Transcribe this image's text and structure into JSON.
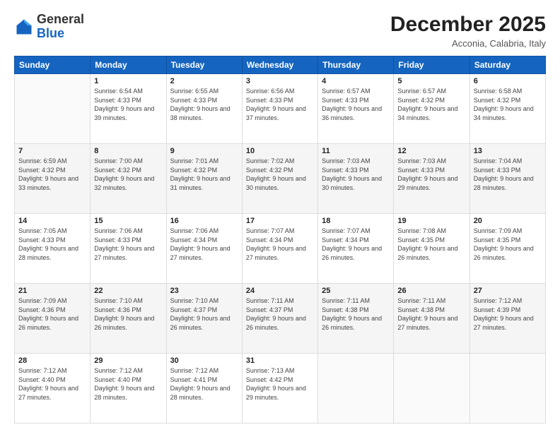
{
  "header": {
    "logo_general": "General",
    "logo_blue": "Blue",
    "title": "December 2025",
    "subtitle": "Acconia, Calabria, Italy"
  },
  "weekdays": [
    "Sunday",
    "Monday",
    "Tuesday",
    "Wednesday",
    "Thursday",
    "Friday",
    "Saturday"
  ],
  "weeks": [
    [
      {
        "day": "",
        "sunrise": "",
        "sunset": "",
        "daylight": ""
      },
      {
        "day": "1",
        "sunrise": "Sunrise: 6:54 AM",
        "sunset": "Sunset: 4:33 PM",
        "daylight": "Daylight: 9 hours and 39 minutes."
      },
      {
        "day": "2",
        "sunrise": "Sunrise: 6:55 AM",
        "sunset": "Sunset: 4:33 PM",
        "daylight": "Daylight: 9 hours and 38 minutes."
      },
      {
        "day": "3",
        "sunrise": "Sunrise: 6:56 AM",
        "sunset": "Sunset: 4:33 PM",
        "daylight": "Daylight: 9 hours and 37 minutes."
      },
      {
        "day": "4",
        "sunrise": "Sunrise: 6:57 AM",
        "sunset": "Sunset: 4:33 PM",
        "daylight": "Daylight: 9 hours and 36 minutes."
      },
      {
        "day": "5",
        "sunrise": "Sunrise: 6:57 AM",
        "sunset": "Sunset: 4:32 PM",
        "daylight": "Daylight: 9 hours and 34 minutes."
      },
      {
        "day": "6",
        "sunrise": "Sunrise: 6:58 AM",
        "sunset": "Sunset: 4:32 PM",
        "daylight": "Daylight: 9 hours and 34 minutes."
      }
    ],
    [
      {
        "day": "7",
        "sunrise": "Sunrise: 6:59 AM",
        "sunset": "Sunset: 4:32 PM",
        "daylight": "Daylight: 9 hours and 33 minutes."
      },
      {
        "day": "8",
        "sunrise": "Sunrise: 7:00 AM",
        "sunset": "Sunset: 4:32 PM",
        "daylight": "Daylight: 9 hours and 32 minutes."
      },
      {
        "day": "9",
        "sunrise": "Sunrise: 7:01 AM",
        "sunset": "Sunset: 4:32 PM",
        "daylight": "Daylight: 9 hours and 31 minutes."
      },
      {
        "day": "10",
        "sunrise": "Sunrise: 7:02 AM",
        "sunset": "Sunset: 4:32 PM",
        "daylight": "Daylight: 9 hours and 30 minutes."
      },
      {
        "day": "11",
        "sunrise": "Sunrise: 7:03 AM",
        "sunset": "Sunset: 4:33 PM",
        "daylight": "Daylight: 9 hours and 30 minutes."
      },
      {
        "day": "12",
        "sunrise": "Sunrise: 7:03 AM",
        "sunset": "Sunset: 4:33 PM",
        "daylight": "Daylight: 9 hours and 29 minutes."
      },
      {
        "day": "13",
        "sunrise": "Sunrise: 7:04 AM",
        "sunset": "Sunset: 4:33 PM",
        "daylight": "Daylight: 9 hours and 28 minutes."
      }
    ],
    [
      {
        "day": "14",
        "sunrise": "Sunrise: 7:05 AM",
        "sunset": "Sunset: 4:33 PM",
        "daylight": "Daylight: 9 hours and 28 minutes."
      },
      {
        "day": "15",
        "sunrise": "Sunrise: 7:06 AM",
        "sunset": "Sunset: 4:33 PM",
        "daylight": "Daylight: 9 hours and 27 minutes."
      },
      {
        "day": "16",
        "sunrise": "Sunrise: 7:06 AM",
        "sunset": "Sunset: 4:34 PM",
        "daylight": "Daylight: 9 hours and 27 minutes."
      },
      {
        "day": "17",
        "sunrise": "Sunrise: 7:07 AM",
        "sunset": "Sunset: 4:34 PM",
        "daylight": "Daylight: 9 hours and 27 minutes."
      },
      {
        "day": "18",
        "sunrise": "Sunrise: 7:07 AM",
        "sunset": "Sunset: 4:34 PM",
        "daylight": "Daylight: 9 hours and 26 minutes."
      },
      {
        "day": "19",
        "sunrise": "Sunrise: 7:08 AM",
        "sunset": "Sunset: 4:35 PM",
        "daylight": "Daylight: 9 hours and 26 minutes."
      },
      {
        "day": "20",
        "sunrise": "Sunrise: 7:09 AM",
        "sunset": "Sunset: 4:35 PM",
        "daylight": "Daylight: 9 hours and 26 minutes."
      }
    ],
    [
      {
        "day": "21",
        "sunrise": "Sunrise: 7:09 AM",
        "sunset": "Sunset: 4:36 PM",
        "daylight": "Daylight: 9 hours and 26 minutes."
      },
      {
        "day": "22",
        "sunrise": "Sunrise: 7:10 AM",
        "sunset": "Sunset: 4:36 PM",
        "daylight": "Daylight: 9 hours and 26 minutes."
      },
      {
        "day": "23",
        "sunrise": "Sunrise: 7:10 AM",
        "sunset": "Sunset: 4:37 PM",
        "daylight": "Daylight: 9 hours and 26 minutes."
      },
      {
        "day": "24",
        "sunrise": "Sunrise: 7:11 AM",
        "sunset": "Sunset: 4:37 PM",
        "daylight": "Daylight: 9 hours and 26 minutes."
      },
      {
        "day": "25",
        "sunrise": "Sunrise: 7:11 AM",
        "sunset": "Sunset: 4:38 PM",
        "daylight": "Daylight: 9 hours and 26 minutes."
      },
      {
        "day": "26",
        "sunrise": "Sunrise: 7:11 AM",
        "sunset": "Sunset: 4:38 PM",
        "daylight": "Daylight: 9 hours and 27 minutes."
      },
      {
        "day": "27",
        "sunrise": "Sunrise: 7:12 AM",
        "sunset": "Sunset: 4:39 PM",
        "daylight": "Daylight: 9 hours and 27 minutes."
      }
    ],
    [
      {
        "day": "28",
        "sunrise": "Sunrise: 7:12 AM",
        "sunset": "Sunset: 4:40 PM",
        "daylight": "Daylight: 9 hours and 27 minutes."
      },
      {
        "day": "29",
        "sunrise": "Sunrise: 7:12 AM",
        "sunset": "Sunset: 4:40 PM",
        "daylight": "Daylight: 9 hours and 28 minutes."
      },
      {
        "day": "30",
        "sunrise": "Sunrise: 7:12 AM",
        "sunset": "Sunset: 4:41 PM",
        "daylight": "Daylight: 9 hours and 28 minutes."
      },
      {
        "day": "31",
        "sunrise": "Sunrise: 7:13 AM",
        "sunset": "Sunset: 4:42 PM",
        "daylight": "Daylight: 9 hours and 29 minutes."
      },
      {
        "day": "",
        "sunrise": "",
        "sunset": "",
        "daylight": ""
      },
      {
        "day": "",
        "sunrise": "",
        "sunset": "",
        "daylight": ""
      },
      {
        "day": "",
        "sunrise": "",
        "sunset": "",
        "daylight": ""
      }
    ]
  ]
}
